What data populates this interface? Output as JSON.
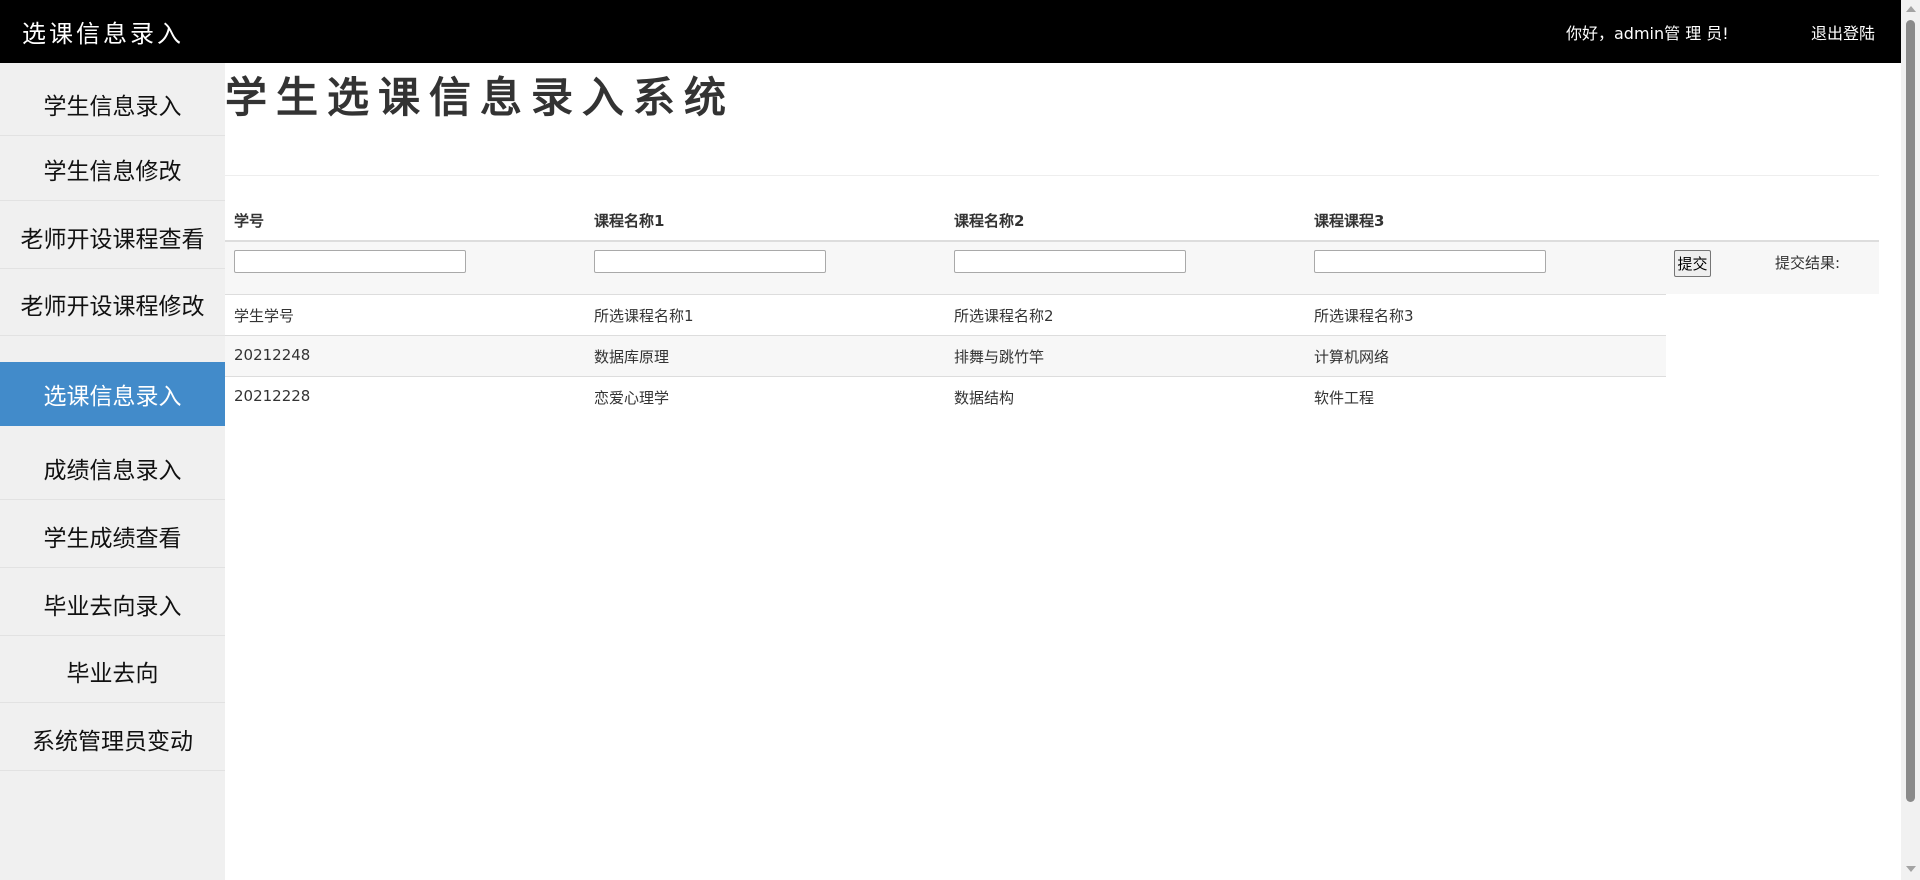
{
  "header": {
    "brand": "选课信息录入",
    "greeting": "你好，admin管 理 员!",
    "logout_label": "退出登陆"
  },
  "sidebar": {
    "items": [
      {
        "label": "学生信息录入"
      },
      {
        "label": "学生信息修改"
      },
      {
        "label": "老师开设课程查看"
      },
      {
        "label": "老师开设课程修改"
      },
      {
        "label": "选课信息录入",
        "active": true
      },
      {
        "label": "成绩信息录入"
      },
      {
        "label": "学生成绩查看"
      },
      {
        "label": "毕业去向录入"
      },
      {
        "label": "毕业去向"
      },
      {
        "label": "系统管理员变动"
      }
    ]
  },
  "main": {
    "title": "学生选课信息录入系统",
    "form": {
      "headers": [
        "学号",
        "课程名称1",
        "课程名称2",
        "课程课程3"
      ],
      "inputs": [
        {
          "value": "",
          "placeholder": ""
        },
        {
          "value": "",
          "placeholder": ""
        },
        {
          "value": "",
          "placeholder": ""
        },
        {
          "value": "",
          "placeholder": ""
        }
      ],
      "submit_label": "提交",
      "result_label": "提交结果:"
    },
    "table": {
      "columns": [
        "学生学号",
        "所选课程名称1",
        "所选课程名称2",
        "所选课程名称3"
      ],
      "rows": [
        [
          "20212248",
          "数据库原理",
          "排舞与跳竹竿",
          "计算机网络"
        ],
        [
          "20212228",
          "恋爱心理学",
          "数据结构",
          "软件工程"
        ]
      ]
    }
  },
  "colors": {
    "topbar": "#000000",
    "sidebar": "#f0f0f0",
    "active_item": "#428bca"
  }
}
